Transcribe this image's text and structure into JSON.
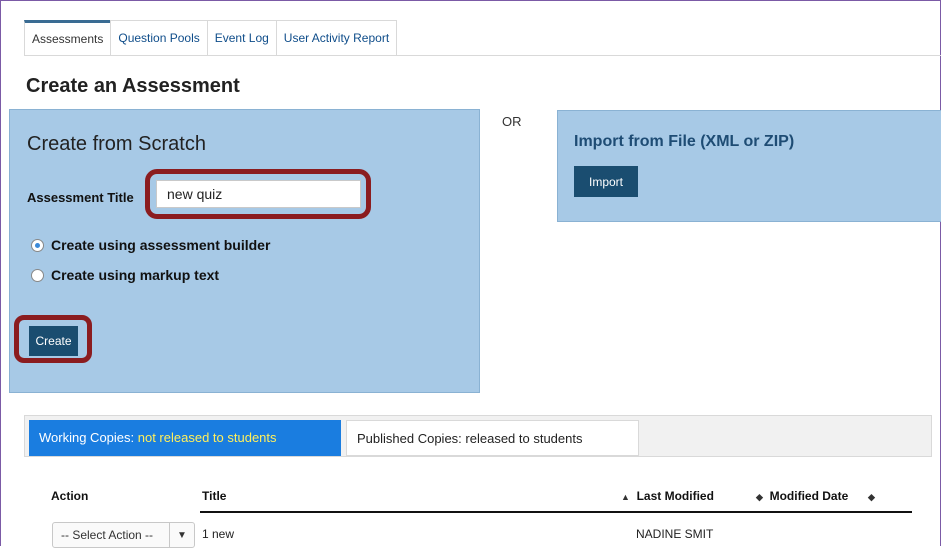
{
  "tabs": [
    "Assessments",
    "Question Pools",
    "Event Log",
    "User Activity Report"
  ],
  "page_title": "Create an Assessment",
  "scratch": {
    "title": "Create from Scratch",
    "title_label": "Assessment Title",
    "title_value": "new quiz",
    "option_builder": "Create using assessment builder",
    "option_markup": "Create using markup text",
    "create_label": "Create"
  },
  "or_label": "OR",
  "import": {
    "title": "Import from File (XML or ZIP)",
    "button_label": "Import"
  },
  "copy_tabs": {
    "working_label": "Working Copies:",
    "working_sub": " not released to students",
    "published_label": "Published Copies:",
    "published_sub": " released to students"
  },
  "table": {
    "headers": {
      "action": "Action",
      "title": "Title",
      "last_modified": "Last Modified",
      "modified_date": "Modified Date"
    },
    "rows": [
      {
        "action": "-- Select Action --",
        "title": "1 new",
        "last_modified": "NADINE SMIT"
      }
    ]
  },
  "colors": {
    "panel": "#a7c9e6",
    "highlight": "#8b1c1f",
    "button": "#1a4d70",
    "active_tab": "#1a7de0"
  }
}
